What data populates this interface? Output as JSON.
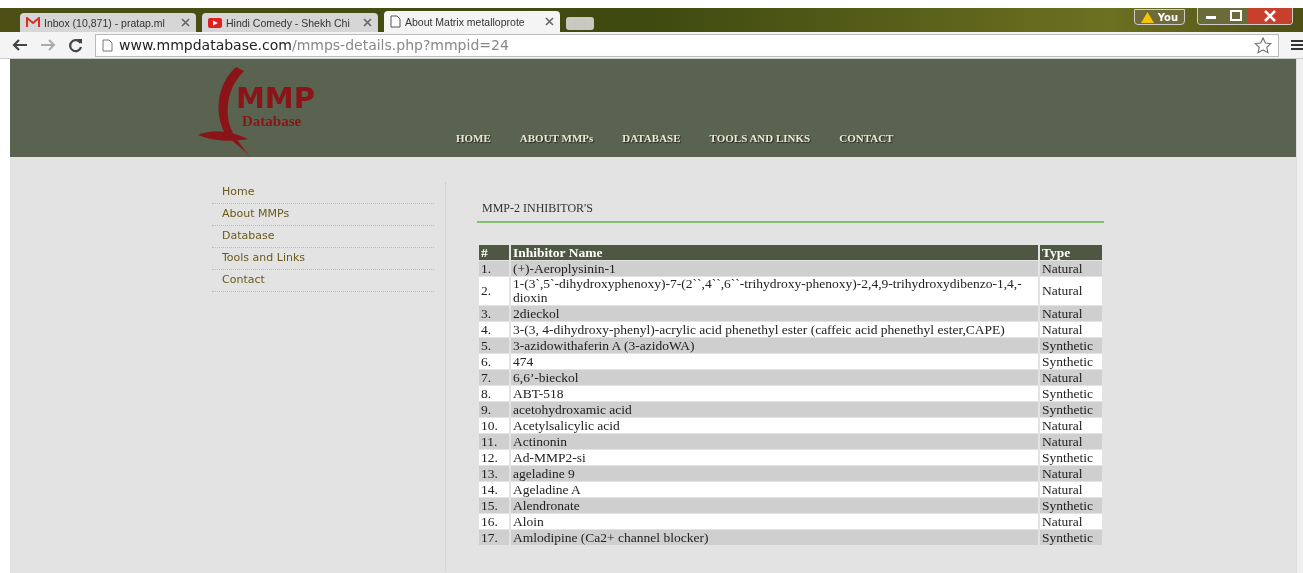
{
  "browser": {
    "tabs": [
      {
        "title": "Inbox (10,871) - pratap.ml",
        "kind": "mail",
        "selected": false
      },
      {
        "title": "Hindi Comedy - Shekh Chi",
        "kind": "video",
        "selected": false
      },
      {
        "title": "About Matrix metalloprote",
        "kind": "page",
        "selected": true
      }
    ],
    "profile": "You",
    "url_host": "www.mmpdatabase.com",
    "url_path": "/mmps-details.php?mmpid=24"
  },
  "logo": {
    "title": "MMP",
    "subtitle": "Database"
  },
  "nav": [
    "HOME",
    "ABOUT MMPs",
    "DATABASE",
    "TOOLS AND LINKS",
    "CONTACT"
  ],
  "sidebar": {
    "items": [
      "Home",
      "About MMPs",
      "Database",
      "Tools and Links",
      "Contact"
    ]
  },
  "heading": "MMP-2 INHIBITOR'S",
  "table": {
    "columns": [
      "#",
      "Inhibitor Name",
      "Type"
    ],
    "rows": [
      [
        "1.",
        "(+)-Aeroplysinin-1",
        "Natural"
      ],
      [
        "2.",
        "1-(3`,5`-dihydroxyphenoxy)-7-(2``,4``,6``-trihydroxy-phenoxy)-2,4,9-trihydroxydibenzo-1,4,-dioxin",
        "Natural"
      ],
      [
        "3.",
        "2dieckol",
        "Natural"
      ],
      [
        "4.",
        "3-(3, 4-dihydroxy-phenyl)-acrylic acid phenethyl ester (caffeic acid phenethyl ester,CAPE)",
        "Natural"
      ],
      [
        "5.",
        "3-azidowithaferin A (3-azidoWA)",
        "Synthetic"
      ],
      [
        "6.",
        "474",
        "Synthetic"
      ],
      [
        "7.",
        "6,6’-bieckol",
        "Natural"
      ],
      [
        "8.",
        "ABT-518",
        "Synthetic"
      ],
      [
        "9.",
        "acetohydroxamic acid",
        "Synthetic"
      ],
      [
        "10.",
        "Acetylsalicylic acid",
        "Natural"
      ],
      [
        "11.",
        "Actinonin",
        "Natural"
      ],
      [
        "12.",
        "Ad-MMP2-si",
        "Synthetic"
      ],
      [
        "13.",
        "ageladine 9",
        "Natural"
      ],
      [
        "14.",
        "Ageladine A",
        "Natural"
      ],
      [
        "15.",
        "Alendronate",
        "Synthetic"
      ],
      [
        "16.",
        "Aloin",
        "Natural"
      ],
      [
        "17.",
        "Amlodipine (Ca2+ channel blocker)",
        "Synthetic"
      ]
    ]
  }
}
